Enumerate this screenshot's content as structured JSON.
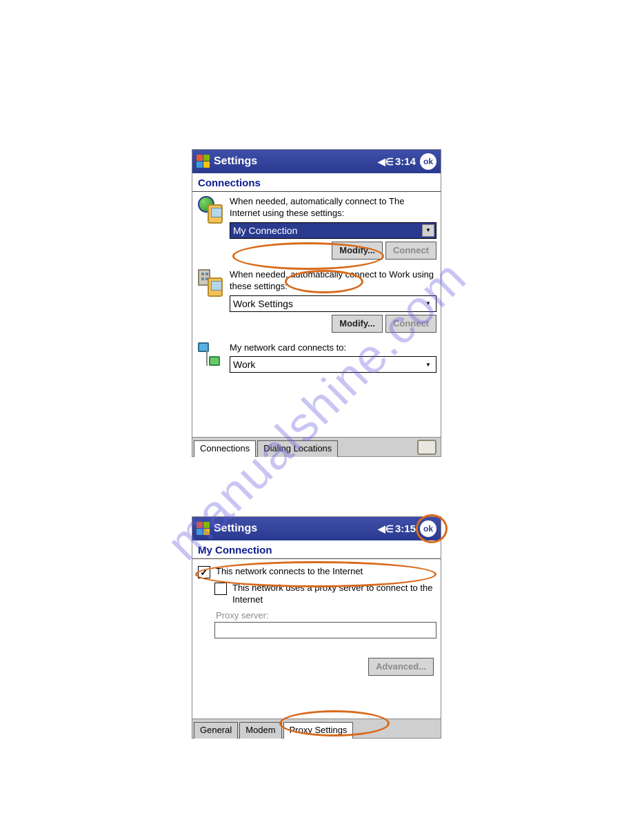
{
  "watermark": "manualshine.com",
  "screen1": {
    "navbar": {
      "title": "Settings",
      "time": "3:14",
      "ok": "ok"
    },
    "page_title": "Connections",
    "internet": {
      "label": "When needed, automatically connect to The Internet using these settings:",
      "dropdown": "My Connection",
      "modify": "Modify...",
      "connect": "Connect"
    },
    "work": {
      "label": "When needed, automatically connect to Work using these settings:",
      "dropdown": "Work Settings",
      "modify": "Modify...",
      "connect": "Connect"
    },
    "card": {
      "label": "My network card connects to:",
      "dropdown": "Work"
    },
    "tabs": {
      "tab1": "Connections",
      "tab2": "Dialing Locations"
    }
  },
  "screen2": {
    "navbar": {
      "title": "Settings",
      "time": "3:15",
      "ok": "ok"
    },
    "page_title": "My Connection",
    "chk_internet": "This network connects to the Internet",
    "chk_proxy": "This network uses a proxy server to connect to the Internet",
    "proxy_label": "Proxy server:",
    "advanced": "Advanced...",
    "tabs": {
      "tab1": "General",
      "tab2": "Modem",
      "tab3": "Proxy Settings"
    }
  }
}
